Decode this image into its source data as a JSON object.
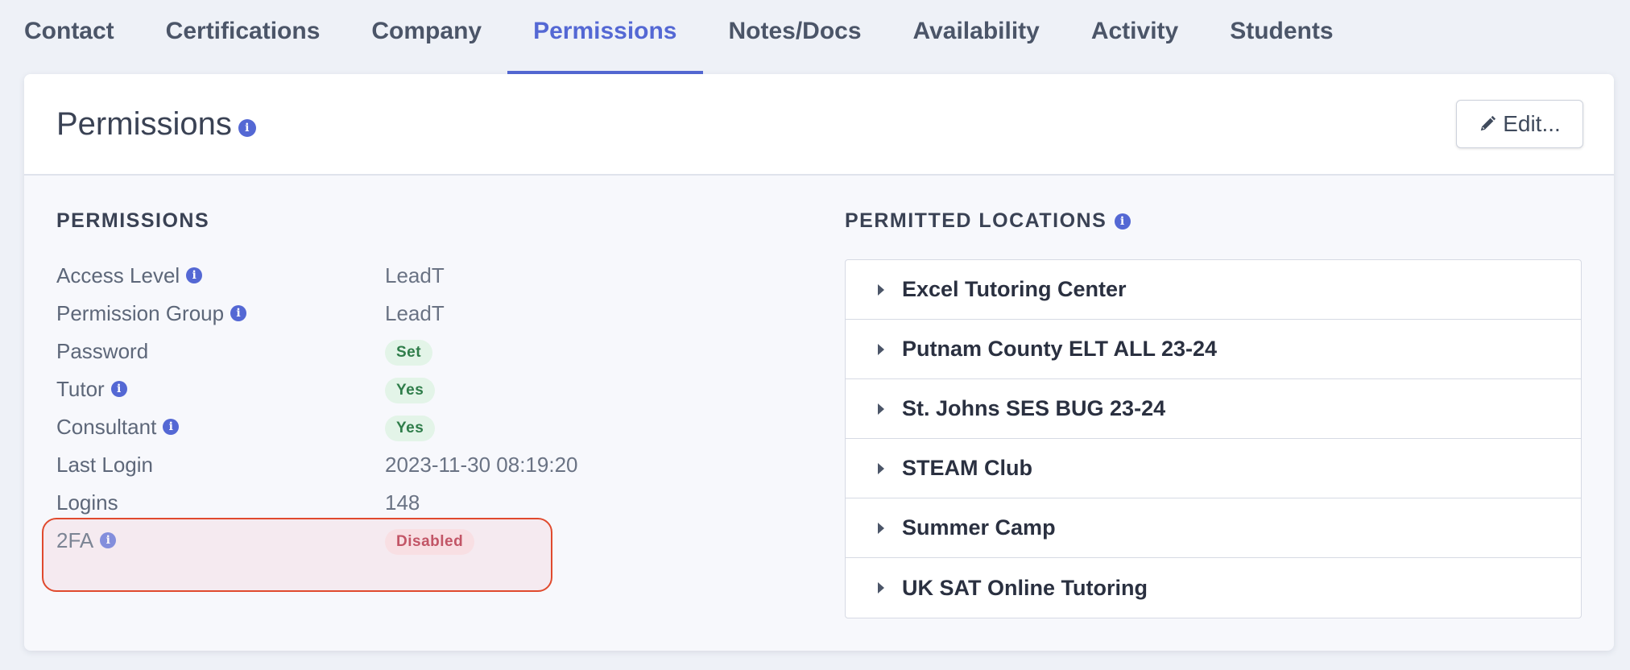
{
  "tabs": [
    {
      "label": "Contact"
    },
    {
      "label": "Certifications"
    },
    {
      "label": "Company"
    },
    {
      "label": "Permissions",
      "active": true
    },
    {
      "label": "Notes/Docs"
    },
    {
      "label": "Availability"
    },
    {
      "label": "Activity"
    },
    {
      "label": "Students"
    }
  ],
  "header": {
    "title": "Permissions",
    "edit_label": "Edit..."
  },
  "permissions": {
    "section_title": "PERMISSIONS",
    "rows": [
      {
        "label": "Access Level",
        "value": "LeadT",
        "info": true,
        "type": "text"
      },
      {
        "label": "Permission Group",
        "value": "LeadT",
        "info": true,
        "type": "text"
      },
      {
        "label": "Password",
        "value": "Set",
        "info": false,
        "type": "badge-green"
      },
      {
        "label": "Tutor",
        "value": "Yes",
        "info": true,
        "type": "badge-green"
      },
      {
        "label": "Consultant",
        "value": "Yes",
        "info": true,
        "type": "badge-green"
      },
      {
        "label": "Last Login",
        "value": "2023-11-30 08:19:20",
        "info": false,
        "type": "text"
      },
      {
        "label": "Logins",
        "value": "148",
        "info": false,
        "type": "text"
      },
      {
        "label": "2FA",
        "value": "Disabled",
        "info": true,
        "type": "badge-red"
      }
    ]
  },
  "locations": {
    "section_title": "PERMITTED LOCATIONS",
    "items": [
      "Excel Tutoring Center",
      "Putnam County ELT ALL 23-24",
      "St. Johns SES BUG 23-24",
      "STEAM Club",
      "Summer Camp",
      "UK SAT Online Tutoring"
    ]
  },
  "colors": {
    "accent": "#5468d4",
    "highlight_border": "#e04a2e"
  }
}
